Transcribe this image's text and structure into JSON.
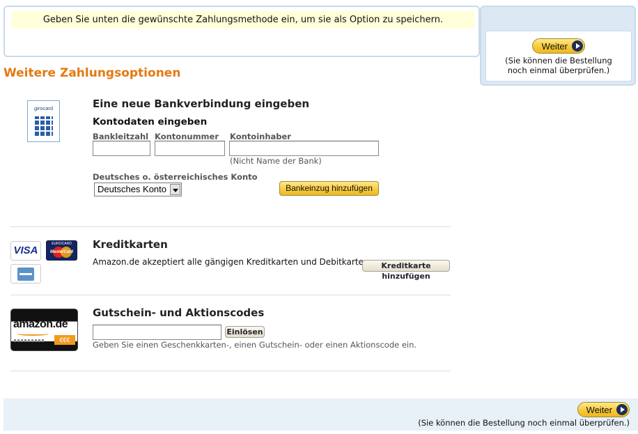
{
  "notice": {
    "text": "Geben Sie unten die gewünschte Zahlungsmethode ein, um sie als Option zu speichern."
  },
  "continue_top": {
    "button_label": "Weiter",
    "note_line1": "(Sie können die Bestellung",
    "note_line2": "noch einmal überprüfen.)"
  },
  "section_title": "Weitere Zahlungsoptionen",
  "bank": {
    "logo_text": "girocard",
    "heading": "Eine neue Bankverbindung eingeben",
    "subheading": "Kontodaten eingeben",
    "label_blz": "Bankleitzahl",
    "label_kontonummer": "Kontonummer",
    "label_inhaber": "Kontoinhaber",
    "inhaber_hint": "(Nicht Name der Bank)",
    "country_label": "Deutsches o. österreichisches Konto",
    "country_selected": "Deutsches Konto",
    "add_button": "Bankeinzug hinzufügen"
  },
  "cards": {
    "visa_text": "VISA",
    "mc_top": "EUROCARD",
    "mc_brand": "MasterCard",
    "heading": "Kreditkarten",
    "description": "Amazon.de akzeptiert alle gängigen Kreditkarten und Debitkarten.",
    "add_button": "Kreditkarte hinzufügen"
  },
  "gift": {
    "logo_text": "amazon.de",
    "logo_badge": "€€€",
    "heading": "Gutschein- und Aktionscodes",
    "redeem_button": "Einlösen",
    "hint": "Geben Sie einen Geschenkkarten-, einen Gutschein- oder einen Aktionscode ein."
  },
  "continue_bottom": {
    "button_label": "Weiter",
    "note": "(Sie können die Bestellung noch einmal überprüfen.)"
  }
}
